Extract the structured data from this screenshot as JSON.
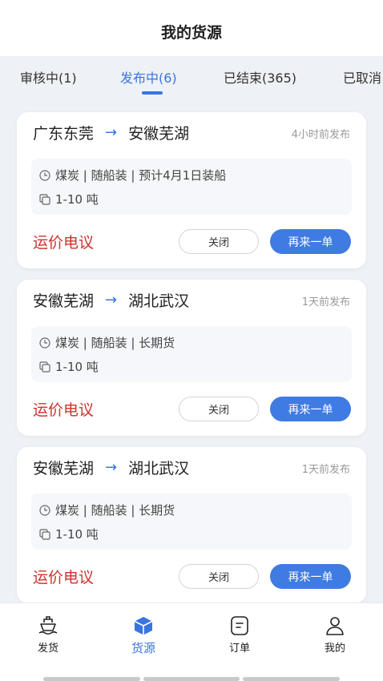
{
  "header": {
    "title": "我的货源"
  },
  "tabs": [
    {
      "label": "审核中(1)",
      "active": false
    },
    {
      "label": "发布中(6)",
      "active": true
    },
    {
      "label": "已结束(365)",
      "active": false
    },
    {
      "label": "已取消",
      "active": false
    }
  ],
  "cards": [
    {
      "from": "广东东莞",
      "to": "安徽芜湖",
      "arrow": "→",
      "time": "4小时前发布",
      "detail": "煤炭 | 随船装 | 预计4月1日装船",
      "weight": "1-10 吨",
      "price": "运价电议",
      "close_label": "关闭",
      "again_label": "再来一单"
    },
    {
      "from": "安徽芜湖",
      "to": "湖北武汉",
      "arrow": "→",
      "time": "1天前发布",
      "detail": "煤炭 | 随船装 | 长期货",
      "weight": "1-10 吨",
      "price": "运价电议",
      "close_label": "关闭",
      "again_label": "再来一单"
    },
    {
      "from": "安徽芜湖",
      "to": "湖北武汉",
      "arrow": "→",
      "time": "1天前发布",
      "detail": "煤炭 | 随船装 | 长期货",
      "weight": "1-10 吨",
      "price": "运价电议",
      "close_label": "关闭",
      "again_label": "再来一单"
    }
  ],
  "bottom_nav": [
    {
      "label": "发货",
      "icon": "ship-icon",
      "active": false
    },
    {
      "label": "货源",
      "icon": "cube-icon",
      "active": true
    },
    {
      "label": "订单",
      "icon": "order-icon",
      "active": false
    },
    {
      "label": "我的",
      "icon": "user-icon",
      "active": false
    }
  ],
  "colors": {
    "accent": "#3a74e0",
    "price": "#d0312d",
    "background": "#eef1f5"
  }
}
